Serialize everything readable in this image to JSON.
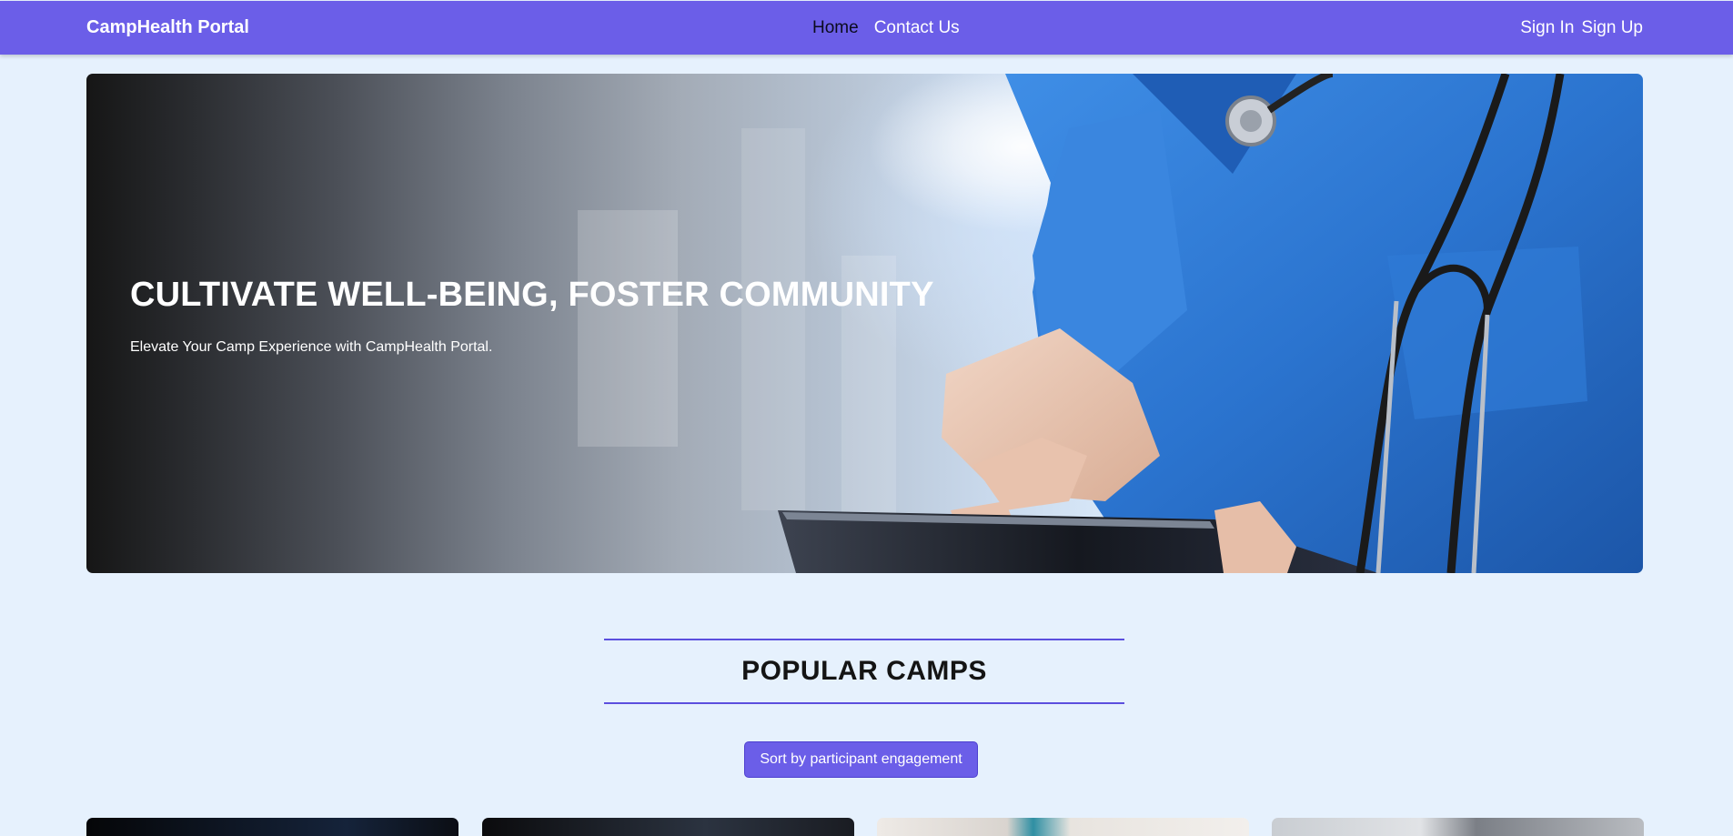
{
  "nav": {
    "brand": "CampHealth Portal",
    "links": [
      {
        "label": "Home",
        "active": true
      },
      {
        "label": "Contact Us",
        "active": false
      }
    ],
    "auth": {
      "sign_in": "Sign In",
      "sign_up": "Sign Up"
    }
  },
  "hero": {
    "title": "CULTIVATE WELL-BEING, FOSTER COMMUNITY",
    "subtitle": "Elevate Your Camp Experience with CampHealth Portal.",
    "image_icon": "doctor-with-tablet-photo"
  },
  "popular": {
    "title": "POPULAR CAMPS",
    "sort_label": "Sort by participant engagement",
    "cards": [
      {
        "image_icon": "camp-image"
      },
      {
        "image_icon": "camp-image"
      },
      {
        "image_icon": "camp-image"
      },
      {
        "image_icon": "camp-image"
      }
    ]
  },
  "colors": {
    "accent": "#6b5ee8",
    "accent_dark": "#5b4fde",
    "page_background": "#e6f1fd",
    "active_link": "#0b0b1e"
  }
}
